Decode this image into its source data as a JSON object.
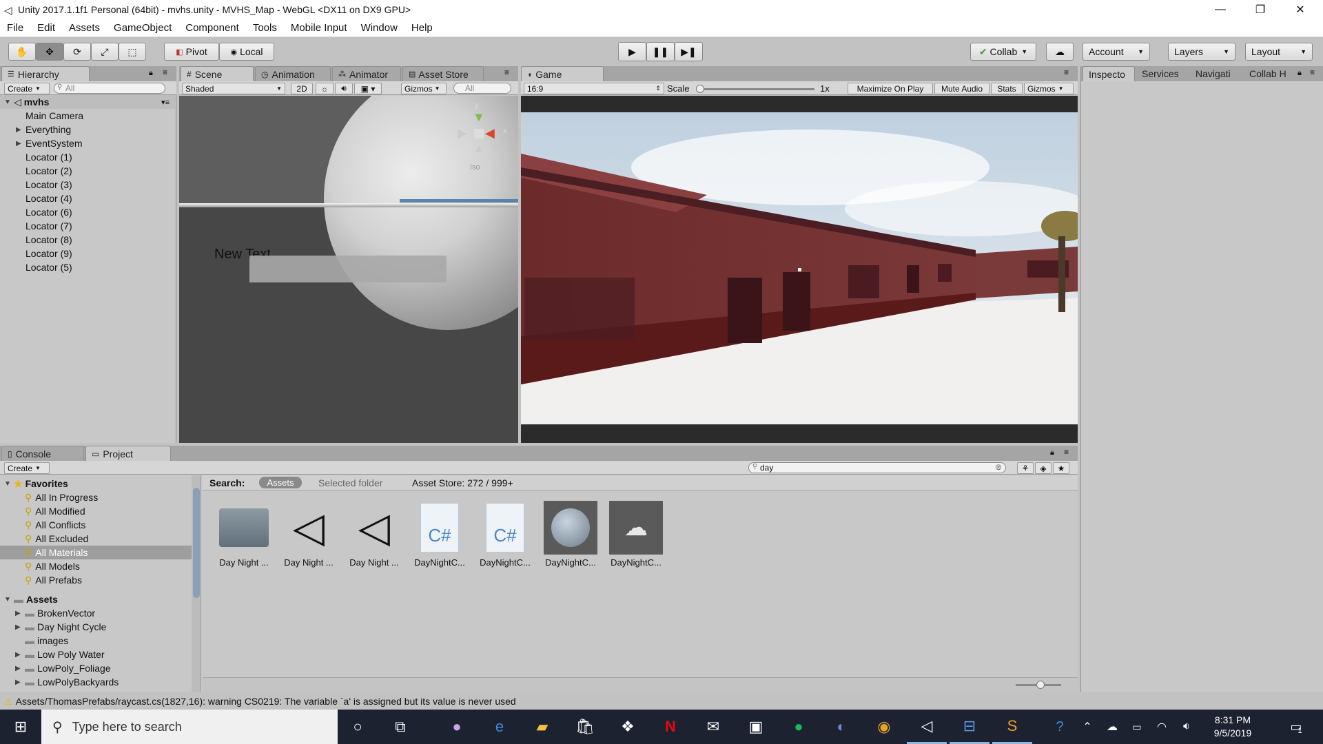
{
  "window": {
    "title": "Unity 2017.1.1f1 Personal (64bit) - mvhs.unity - MVHS_Map - WebGL <DX11 on DX9 GPU>"
  },
  "menu": [
    "File",
    "Edit",
    "Assets",
    "GameObject",
    "Component",
    "Tools",
    "Mobile Input",
    "Window",
    "Help"
  ],
  "toolbar": {
    "pivot": "Pivot",
    "local": "Local",
    "collab": "Collab",
    "account": "Account",
    "layers": "Layers",
    "layout": "Layout"
  },
  "hierarchy": {
    "tab": "Hierarchy",
    "create": "Create",
    "search_placeholder": "All",
    "scene": "mvhs",
    "items": [
      {
        "label": "Main Camera"
      },
      {
        "label": "Everything"
      },
      {
        "label": "EventSystem"
      },
      {
        "label": "Locator (1)"
      },
      {
        "label": "Locator (2)"
      },
      {
        "label": "Locator (3)"
      },
      {
        "label": "Locator (4)"
      },
      {
        "label": "Locator (6)"
      },
      {
        "label": "Locator (7)"
      },
      {
        "label": "Locator (8)"
      },
      {
        "label": "Locator (9)"
      },
      {
        "label": "Locator (5)"
      }
    ]
  },
  "scene": {
    "tabs": [
      "Scene",
      "Animation",
      "Animator",
      "Asset Store"
    ],
    "shading": "Shaded",
    "mode2d": "2D",
    "gizmos": "Gizmos",
    "search_placeholder": "All",
    "iso": "Iso",
    "text": "New Text"
  },
  "game": {
    "tab": "Game",
    "aspect": "16:9",
    "scale_label": "Scale",
    "scale_value": "1x",
    "maximize": "Maximize On Play",
    "mute": "Mute Audio",
    "stats": "Stats",
    "gizmos": "Gizmos"
  },
  "right_tabs": [
    "Inspecto",
    "Services",
    "Navigati",
    "Collab H"
  ],
  "bottom": {
    "tabs": [
      "Console",
      "Project"
    ],
    "create": "Create",
    "search_value": "day",
    "search_label": "Search:",
    "scope_assets": "Assets",
    "scope_folder": "Selected folder",
    "asset_store": "Asset Store: 272 / 999+"
  },
  "favorites": {
    "title": "Favorites",
    "items": [
      "All In Progress",
      "All Modified",
      "All Conflicts",
      "All Excluded",
      "All Materials",
      "All Models",
      "All Prefabs"
    ]
  },
  "assets_tree": {
    "title": "Assets",
    "items": [
      "BrokenVector",
      "Day Night Cycle",
      "images",
      "Low Poly Water",
      "LowPoly_Foliage",
      "LowPolyBackyards"
    ]
  },
  "assets_grid": [
    {
      "label": "Day Night ...",
      "icon": "folder-icon"
    },
    {
      "label": "Day Night ...",
      "icon": "unity-icon"
    },
    {
      "label": "Day Night ...",
      "icon": "unity-icon"
    },
    {
      "label": "DayNightC...",
      "icon": "csharp-icon"
    },
    {
      "label": "DayNightC...",
      "icon": "csharp-icon"
    },
    {
      "label": "DayNightC...",
      "icon": "material-sphere-icon"
    },
    {
      "label": "DayNightC...",
      "icon": "texture-icon"
    }
  ],
  "status": {
    "text": "Assets/ThomasPrefabs/raycast.cs(1827,16): warning CS0219: The variable `a' is assigned but its value is never used"
  },
  "taskbar": {
    "search_placeholder": "Type here to search",
    "time": "8:31 PM",
    "date": "9/5/2019",
    "notif_count": "1"
  },
  "colors": {
    "accent": "#3a72b0",
    "selected": "#9e9e9e",
    "warning": "#e8b400"
  }
}
